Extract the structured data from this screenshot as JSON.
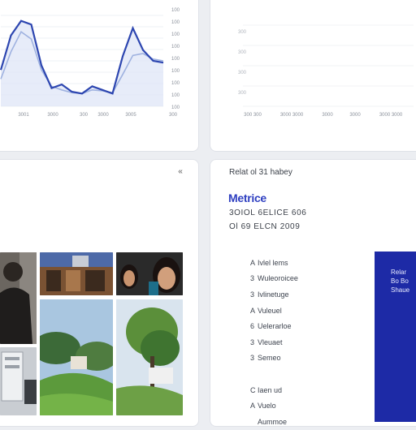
{
  "colors": {
    "accent": "#2d3ec0",
    "line_primary": "#2d46b0",
    "line_secondary": "#9fb2e0",
    "side_panel": "#1d2aa6"
  },
  "chart_left": {
    "x_ticks": [
      "3001",
      "3000",
      "300",
      "3000",
      "3005",
      "300"
    ],
    "y_ticks": [
      "100",
      "100",
      "100",
      "100",
      "100",
      "100",
      "100",
      "100",
      "100"
    ]
  },
  "chart_right": {
    "x_ticks": [
      "300 300",
      "3000 3000",
      "3000",
      "3000",
      "3000 3000"
    ],
    "y_ticks": [
      "300",
      "300",
      "300",
      "300"
    ]
  },
  "chart_data": [
    {
      "type": "line",
      "series": [
        {
          "values": [
            40,
            78,
            94,
            90,
            45,
            20,
            24,
            16,
            14,
            22,
            18,
            14,
            55,
            86,
            62,
            50,
            48
          ]
        },
        {
          "values": [
            30,
            60,
            82,
            74,
            40,
            22,
            18,
            15,
            14,
            18,
            17,
            15,
            35,
            56,
            58,
            52,
            50
          ]
        }
      ],
      "x": [
        0,
        1,
        2,
        3,
        4,
        5,
        6,
        7,
        8,
        9,
        10,
        11,
        12,
        13,
        14,
        15,
        16
      ],
      "ylim": [
        0,
        100
      ]
    },
    {
      "type": "line",
      "series": [],
      "ylim": [
        0,
        100
      ]
    }
  ],
  "detail": {
    "collapse_icon": "chevron-collapse-icon",
    "title": "Relat ol 31 habey",
    "metric_name": "Metrice",
    "line1": "3OIOL 6ELICE 606",
    "line2": "Ol 69 ELCN 2009",
    "list": [
      {
        "marker": "A",
        "label": "Ivlel lems"
      },
      {
        "marker": "3",
        "label": "Wuleoroicee"
      },
      {
        "marker": "3",
        "label": "Ivlinetuge"
      },
      {
        "marker": "A",
        "label": "Vuleuel"
      },
      {
        "marker": "6",
        "label": "Uelerarloe"
      },
      {
        "marker": "3",
        "label": "Vleuaet"
      },
      {
        "marker": "3",
        "label": "Semeo"
      },
      {
        "marker": "",
        "label": ""
      },
      {
        "marker": "C",
        "label": "Iaen   ud"
      },
      {
        "marker": "A",
        "label": "Vuelo"
      },
      {
        "marker": "",
        "label": "Aummoe"
      }
    ],
    "side_panel_lines": [
      "Relar",
      "Bo Bo",
      "Shaue"
    ]
  }
}
